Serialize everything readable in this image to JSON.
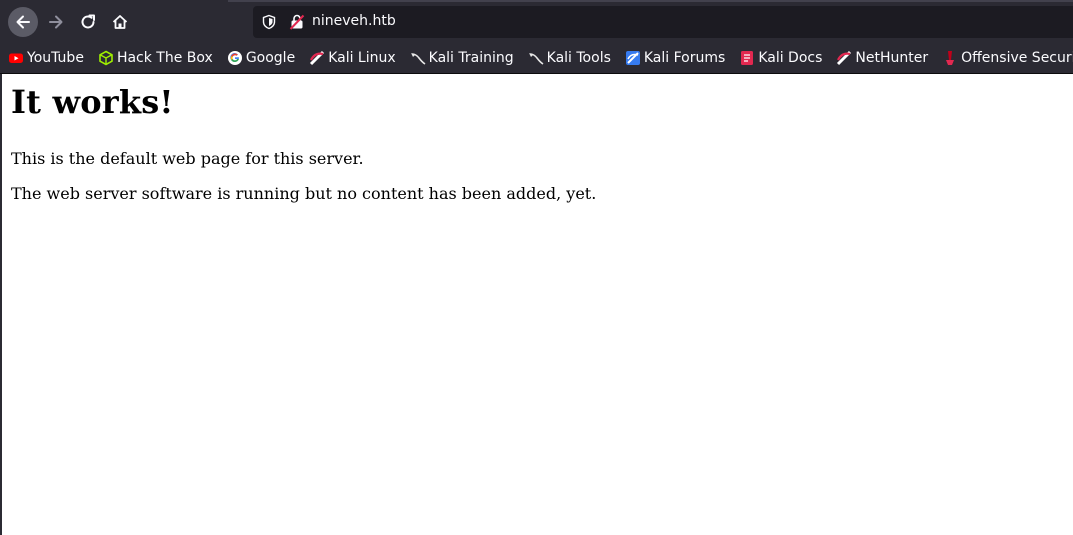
{
  "browser": {
    "url": "nineveh.htb",
    "bookmarks": [
      {
        "label": "YouTube",
        "icon": "youtube-icon"
      },
      {
        "label": "Hack The Box",
        "icon": "hackthebox-icon"
      },
      {
        "label": "Google",
        "icon": "google-icon"
      },
      {
        "label": "Kali Linux",
        "icon": "kali-icon"
      },
      {
        "label": "Kali Training",
        "icon": "kali-dragon-icon"
      },
      {
        "label": "Kali Tools",
        "icon": "kali-dragon-icon"
      },
      {
        "label": "Kali Forums",
        "icon": "kali-forums-icon"
      },
      {
        "label": "Kali Docs",
        "icon": "kali-docs-icon"
      },
      {
        "label": "NetHunter",
        "icon": "kali-icon"
      },
      {
        "label": "Offensive Security",
        "icon": "offsec-icon"
      }
    ]
  },
  "page": {
    "heading": "It works!",
    "paragraph1": "This is the default web page for this server.",
    "paragraph2": "The web server software is running but no content has been added, yet."
  }
}
